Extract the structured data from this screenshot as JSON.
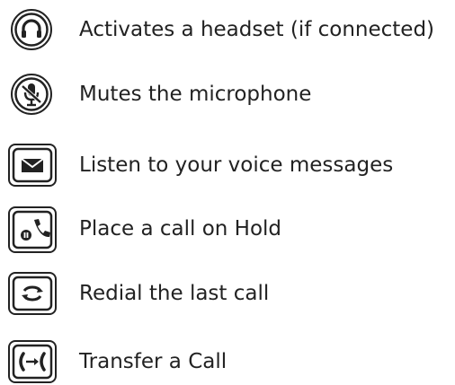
{
  "keys": [
    {
      "icon": "headset-icon",
      "label": "Activates a headset (if connected)"
    },
    {
      "icon": "mute-microphone-icon",
      "label": "Mutes the microphone"
    },
    {
      "icon": "envelope-icon",
      "label": "Listen to your voice messages"
    },
    {
      "icon": "hold-icon",
      "label": "Place a call on Hold"
    },
    {
      "icon": "redial-icon",
      "label": "Redial the last call"
    },
    {
      "icon": "transfer-icon",
      "label": "Transfer a Call"
    }
  ]
}
